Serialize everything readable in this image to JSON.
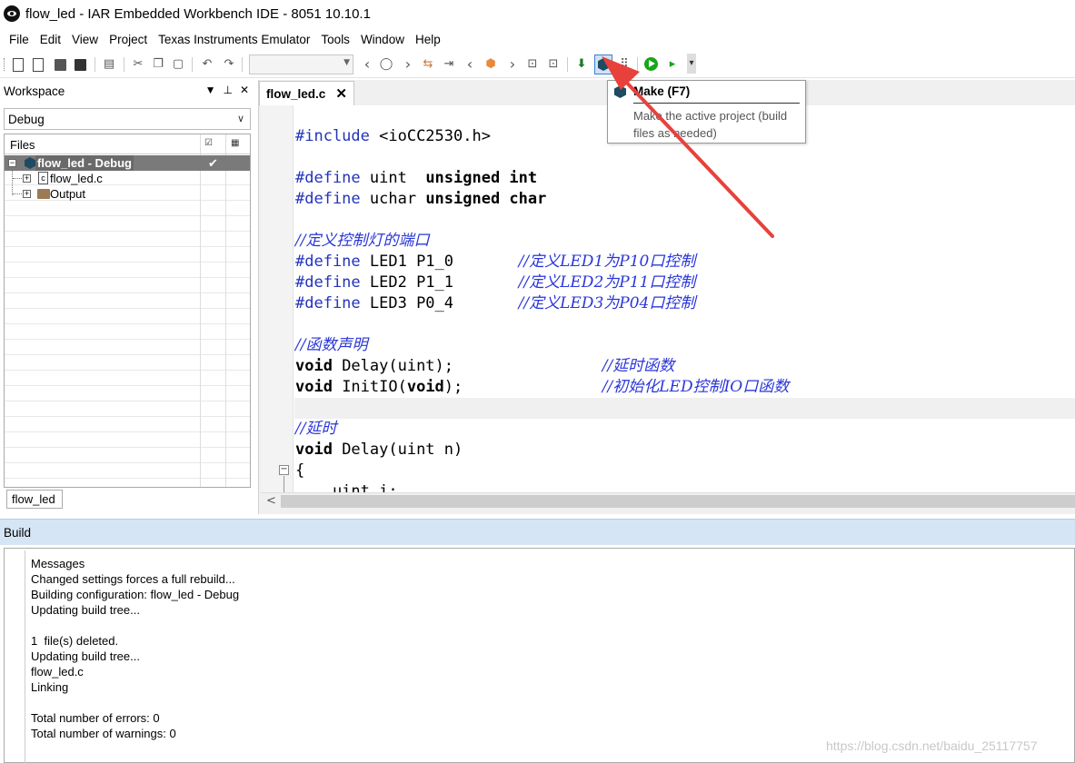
{
  "window": {
    "title": "flow_led - IAR Embedded Workbench IDE - 8051 10.10.1"
  },
  "menu": {
    "items": [
      "File",
      "Edit",
      "View",
      "Project",
      "Texas Instruments Emulator",
      "Tools",
      "Window",
      "Help"
    ]
  },
  "toolbar": {
    "combo_value": "",
    "make_tooltip": {
      "title": "Make (F7)",
      "description": "Make the active project (build files as needed)"
    }
  },
  "workspace": {
    "header": "Workspace",
    "configuration": "Debug",
    "columns": {
      "files": "Files"
    },
    "tree": [
      {
        "label": "flow_led - Debug",
        "check": "✔",
        "expander": "⊟"
      },
      {
        "label": "flow_led.c",
        "expander": "⊞",
        "icon_letter": "c"
      },
      {
        "label": "Output",
        "expander": "⊞"
      }
    ],
    "bottom_tab": "flow_led"
  },
  "editor": {
    "tab_label": "flow_led.c",
    "tab_close": "✕",
    "fold_marker": "⊟",
    "lines": [
      {
        "a": "#include",
        "b": " <ioCC2530.h>"
      },
      {
        "a": "",
        "b": ""
      },
      {
        "a": "#define",
        "b": " uint  ",
        "c": "unsigned int"
      },
      {
        "a": "#define",
        "b": " uchar ",
        "c": "unsigned char"
      },
      {
        "a": "",
        "b": ""
      },
      {
        "cm": "//定义控制灯的端口"
      },
      {
        "a": "#define",
        "b": " LED1 P1_0       ",
        "cm": "//定义LED1为P10口控制"
      },
      {
        "a": "#define",
        "b": " LED2 P1_1       ",
        "cm": "//定义LED2为P11口控制"
      },
      {
        "a": "#define",
        "b": " LED3 P0_4       ",
        "cm": "//定义LED3为P04口控制"
      },
      {
        "a": "",
        "b": ""
      },
      {
        "cm": "//函数声明"
      },
      {
        "k": "void",
        "b": " Delay(uint);                ",
        "cm": "//延时函数"
      },
      {
        "k": "void",
        "b": " InitIO(",
        "k2": "void",
        "b2": ");               ",
        "cm": "//初始化LED控制IO口函数"
      },
      {
        "a": "",
        "b": ""
      },
      {
        "cm": "//延时"
      },
      {
        "k": "void",
        "b": " Delay(uint n)"
      },
      {
        "b": "{"
      },
      {
        "b": "    uint i;"
      }
    ]
  },
  "build": {
    "header": "Build",
    "messages": [
      "Messages",
      "Changed settings forces a full rebuild...",
      "Building configuration: flow_led - Debug",
      "Updating build tree...",
      "",
      "1  file(s) deleted.",
      "Updating build tree...",
      "flow_led.c",
      "Linking",
      "",
      "Total number of errors: 0",
      "Total number of warnings: 0"
    ]
  },
  "watermark": "https://blog.csdn.net/baidu_25117757",
  "colors": {
    "keyword_blue": "#2233bb",
    "comment_blue": "#2a36d8",
    "arrow_red": "#e8413c",
    "build_header": "#d6e5f5",
    "selected_row": "#7a7a7a"
  }
}
